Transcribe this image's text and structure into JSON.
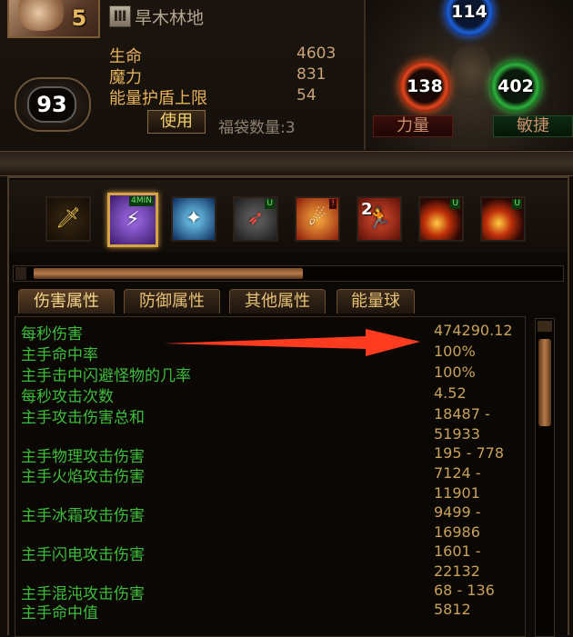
{
  "header": {
    "portrait_badge": "5",
    "tier_numeral": "Ⅲ",
    "zone_name": "旱木林地",
    "level": "93",
    "stats": [
      {
        "label": "生命",
        "value": "4603"
      },
      {
        "label": "魔力",
        "value": "831"
      },
      {
        "label": "能量护盾上限",
        "value": "54"
      }
    ],
    "use_button": "使用",
    "luck_bag": "福袋数量:3"
  },
  "orbs": {
    "intelligence": {
      "value": "114",
      "color": "#1e5fd6"
    },
    "strength": {
      "value": "138",
      "label": "力量",
      "color": "#e3461c"
    },
    "dexterity": {
      "value": "402",
      "label": "敏捷",
      "color": "#2fb03c"
    }
  },
  "skills": [
    {
      "icon": "sword-icon",
      "tag": ""
    },
    {
      "icon": "lightning-bolt-icon",
      "tag": "4MIN"
    },
    {
      "icon": "electric-spark-icon",
      "tag": ""
    },
    {
      "icon": "bow-arrow-icon",
      "tag": "U"
    },
    {
      "icon": "fire-face-icon",
      "tag": "!"
    },
    {
      "icon": "running-man-icon",
      "tag": "",
      "count": "2"
    },
    {
      "icon": "fire-orb-icon",
      "tag": "U"
    },
    {
      "icon": "fire-orb-icon",
      "tag": "U"
    }
  ],
  "tabs": [
    "伤害属性",
    "防御属性",
    "其他属性",
    "能量球"
  ],
  "stats": [
    {
      "label": "每秒伤害",
      "value": "474290.12"
    },
    {
      "label": "主手命中率",
      "value": "100%"
    },
    {
      "label": "主手击中闪避怪物的几率",
      "value": "100%"
    },
    {
      "label": "每秒攻击次数",
      "value": "4.52"
    },
    {
      "label": "主手攻击伤害总和",
      "value": "18487 -",
      "value2": "51933"
    },
    {
      "label": "主手物理攻击伤害",
      "value": "195 - 778"
    },
    {
      "label": "主手火焰攻击伤害",
      "value": "7124 -",
      "value2": "11901"
    },
    {
      "label": "主手冰霜攻击伤害",
      "value": "9499 -",
      "value2": "16986"
    },
    {
      "label": "主手闪电攻击伤害",
      "value": "1601 -",
      "value2": "22132"
    },
    {
      "label": "主手混沌攻击伤害",
      "value": "68 - 136"
    },
    {
      "label": "主手命中值",
      "value": "5812"
    }
  ],
  "colors": {
    "stat_label": "#3ebd3a",
    "stat_value": "#c9a25a",
    "header_label": "#e5b25b",
    "annotation_arrow": "#ff3b1f"
  }
}
